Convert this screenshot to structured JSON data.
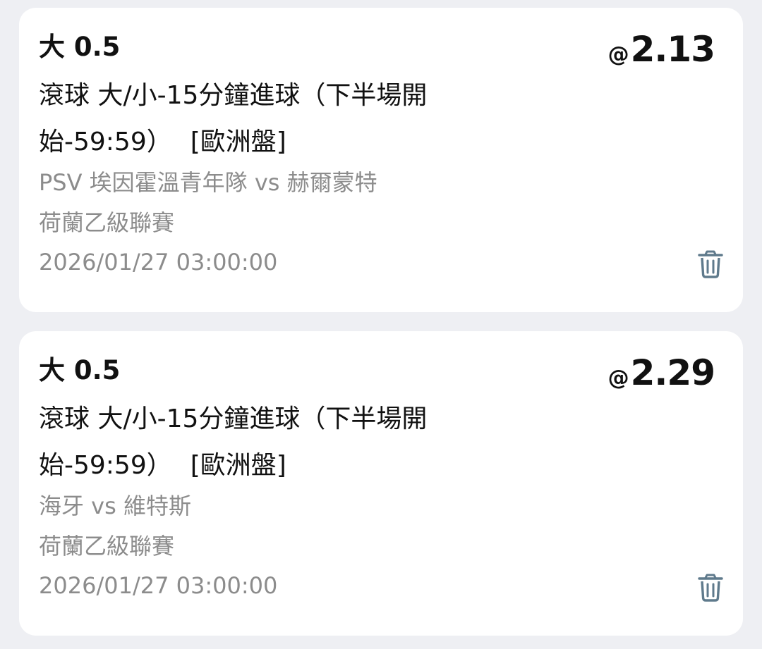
{
  "bets": [
    {
      "selection": "大 0.5",
      "odds_prefix": "@",
      "odds": "2.13",
      "market_line1": "滾球 大/小-15分鐘進球（下半場開",
      "market_line2": "始-59:59）",
      "market_region": "[歐洲盤]",
      "teams": "PSV 埃因霍溫青年隊 vs 赫爾蒙特",
      "league": "荷蘭乙級聯賽",
      "datetime": "2026/01/27 03:00:00",
      "delete_icon": "trash-icon"
    },
    {
      "selection": "大 0.5",
      "odds_prefix": "@",
      "odds": "2.29",
      "market_line1": "滾球 大/小-15分鐘進球（下半場開",
      "market_line2": "始-59:59）",
      "market_region": "[歐洲盤]",
      "teams": "海牙 vs 維特斯",
      "league": "荷蘭乙級聯賽",
      "datetime": "2026/01/27 03:00:00",
      "delete_icon": "trash-icon"
    }
  ],
  "colors": {
    "page_background": "#eeeff3",
    "card_background": "#ffffff",
    "primary_text": "#111111",
    "secondary_text": "#8c8c8c",
    "icon": "#5f7a8c"
  }
}
